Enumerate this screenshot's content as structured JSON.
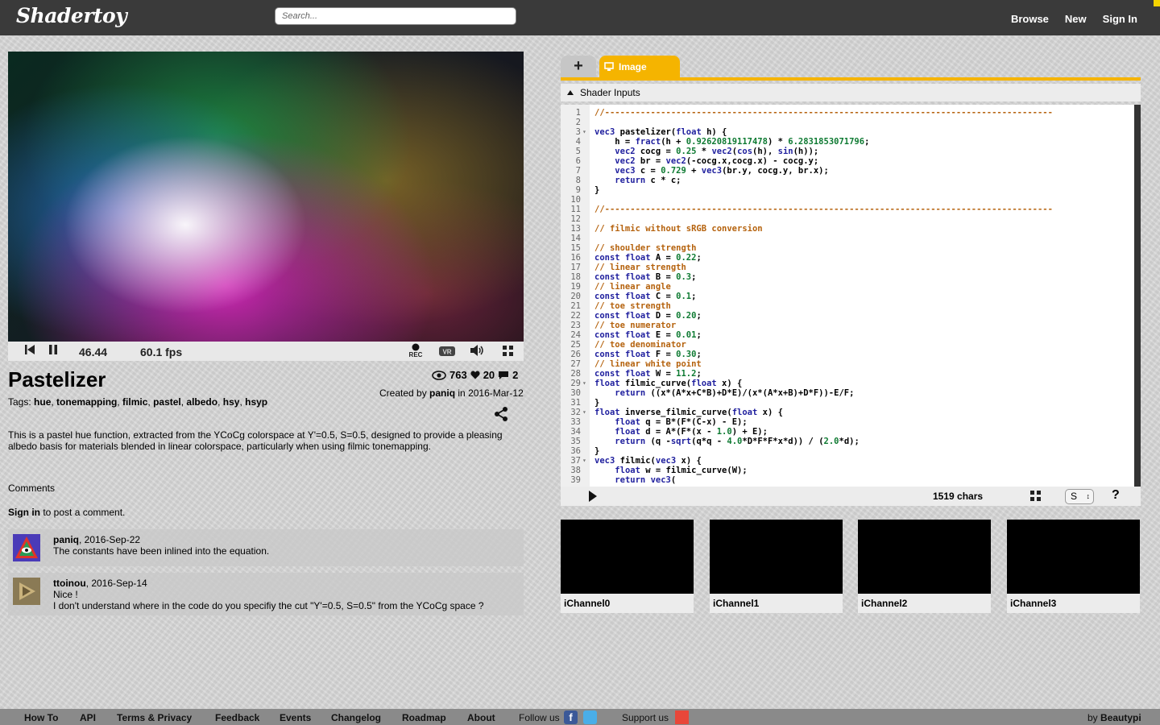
{
  "header": {
    "logo": "Shadertoy",
    "search_placeholder": "Search...",
    "nav": {
      "browse": "Browse",
      "new": "New",
      "signin": "Sign In"
    }
  },
  "player": {
    "time": "46.44",
    "fps": "60.1 fps",
    "rec_label": "REC",
    "vr_label": "VR"
  },
  "shader": {
    "title": "Pastelizer",
    "views": "763",
    "likes": "20",
    "comments_count": "2",
    "tags_prefix": "Tags:",
    "tags": [
      "hue",
      "tonemapping",
      "filmic",
      "pastel",
      "albedo",
      "hsy",
      "hsyp"
    ],
    "created_prefix": "Created by",
    "author": "paniq",
    "created_date": "in 2016-Mar-12",
    "description": "This is a pastel hue function, extracted from the YCoCg colorspace at Y'=0.5, S=0.5, designed to provide a pleasing albedo basis for materials blended in linear colorspace, particularly when using filmic tonemapping."
  },
  "comments": {
    "heading": "Comments",
    "signin_link": "Sign in",
    "signin_suffix": " to post a comment.",
    "items": [
      {
        "user": "paniq",
        "date": ", 2016-Sep-22",
        "lines": [
          "The constants have been inlined into the equation."
        ]
      },
      {
        "user": "ttoinou",
        "date": ", 2016-Sep-14",
        "lines": [
          "Nice !",
          "I don't understand where in the code do you specifiy the cut \"Y'=0.5, S=0.5\" from the YCoCg space ?"
        ]
      }
    ]
  },
  "editor": {
    "add_tab": "+",
    "image_tab": "Image",
    "inputs_label": "Shader Inputs",
    "chars": "1519 chars",
    "font_size": "S",
    "help": "?",
    "lines": [
      "//----------------------------------------------------------------------------------------",
      "",
      "vec3 pastelizer(float h) {",
      "    h = fract(h + 0.92620819117478) * 6.2831853071796;",
      "    vec2 cocg = 0.25 * vec2(cos(h), sin(h));",
      "    vec2 br = vec2(-cocg.x,cocg.x) - cocg.y;",
      "    vec3 c = 0.729 + vec3(br.y, cocg.y, br.x);",
      "    return c * c;",
      "}",
      "",
      "//----------------------------------------------------------------------------------------",
      "",
      "// filmic without sRGB conversion",
      "",
      "// shoulder strength",
      "const float A = 0.22;",
      "// linear strength",
      "const float B = 0.3;",
      "// linear angle",
      "const float C = 0.1;",
      "// toe strength",
      "const float D = 0.20;",
      "// toe numerator",
      "const float E = 0.01;",
      "// toe denominator",
      "const float F = 0.30;",
      "// linear white point",
      "const float W = 11.2;",
      "float filmic_curve(float x) {",
      "    return ((x*(A*x+C*B)+D*E)/(x*(A*x+B)+D*F))-E/F;",
      "}",
      "float inverse_filmic_curve(float x) {",
      "    float q = B*(F*(C-x) - E);",
      "    float d = A*(F*(x - 1.0) + E);",
      "    return (q -sqrt(q*q - 4.0*D*F*F*x*d)) / (2.0*d);",
      "}",
      "vec3 filmic(vec3 x) {",
      "    float w = filmic_curve(W);",
      "    return vec3("
    ],
    "fold_lines": [
      3,
      29,
      32,
      37
    ]
  },
  "channels": [
    "iChannel0",
    "iChannel1",
    "iChannel2",
    "iChannel3"
  ],
  "footer": {
    "how_to": "How To",
    "api": "API",
    "terms": "Terms & Privacy",
    "feedback": "Feedback",
    "events": "Events",
    "changelog": "Changelog",
    "roadmap": "Roadmap",
    "about": "About",
    "follow": "Follow us",
    "support": "Support us",
    "by": "by",
    "credit": "Beautypi"
  },
  "colors": {
    "header_bg": "#3a3a3a",
    "accent": "#f5b400",
    "comment_color": "#b5620d",
    "keyword_color": "#1f1f9e",
    "number_color": "#0e7a32"
  }
}
